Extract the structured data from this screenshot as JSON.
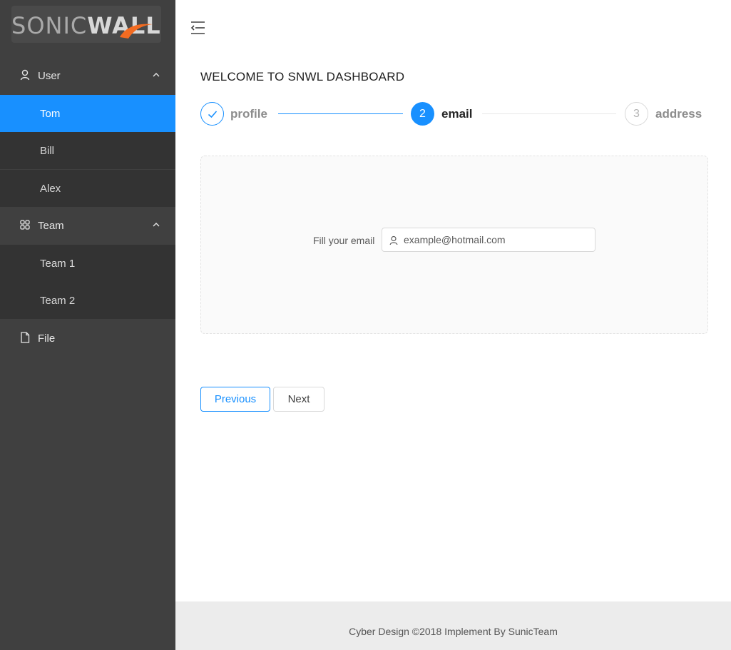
{
  "brand": {
    "logo_text_light": "SONIC",
    "logo_text_bold": "WALL",
    "accent": "#1890ff",
    "logo_swoosh_color": "#f26b21"
  },
  "sidebar": {
    "groups": [
      {
        "label": "User",
        "icon": "user-icon",
        "expanded": true,
        "items": [
          {
            "label": "Tom",
            "active": true
          },
          {
            "label": "Bill"
          },
          {
            "label": "Alex"
          }
        ]
      },
      {
        "label": "Team",
        "icon": "team-icon",
        "expanded": true,
        "items": [
          {
            "label": "Team 1"
          },
          {
            "label": "Team 2"
          }
        ]
      },
      {
        "label": "File",
        "icon": "file-icon"
      }
    ]
  },
  "header": {
    "menu_toggle_icon": "menu-fold-icon"
  },
  "main": {
    "title": "WELCOME TO SNWL DASHBOARD",
    "steps": [
      {
        "number": "1",
        "label": "profile",
        "status": "finished"
      },
      {
        "number": "2",
        "label": "email",
        "status": "current"
      },
      {
        "number": "3",
        "label": "address",
        "status": "waiting"
      }
    ],
    "form": {
      "email_label": "Fill your email",
      "email_placeholder": "example@hotmail.com",
      "email_icon": "user-icon"
    },
    "buttons": {
      "previous": "Previous",
      "next": "Next"
    }
  },
  "footer": {
    "text": "Cyber Design ©2018 Implement By SunicTeam"
  }
}
